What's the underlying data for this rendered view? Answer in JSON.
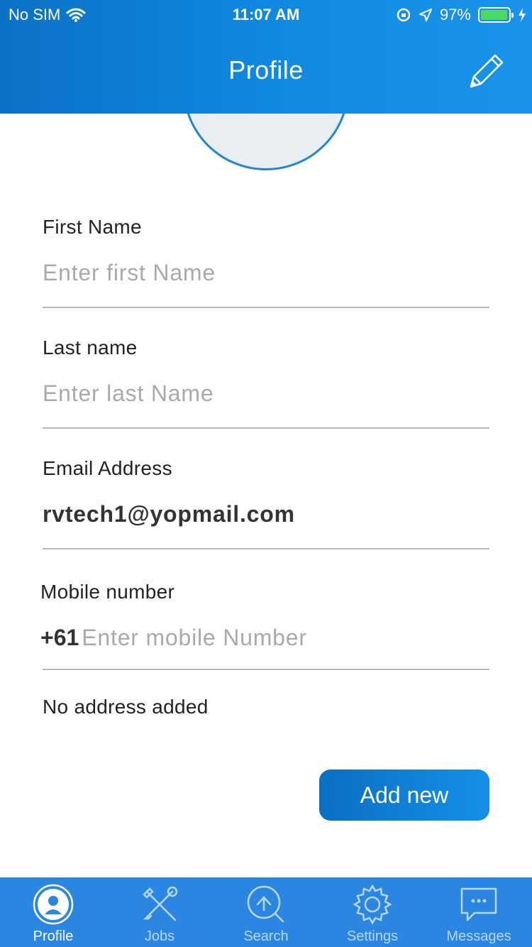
{
  "status_bar": {
    "carrier": "No SIM",
    "time": "11:07 AM",
    "battery_percent": "97%",
    "battery_level": 0.97
  },
  "header": {
    "title": "Profile",
    "edit_icon": "pencil-icon"
  },
  "avatar": {
    "icon": "profile-photo-circle"
  },
  "form": {
    "first_name": {
      "label": "First Name",
      "placeholder": "Enter first Name",
      "value": ""
    },
    "last_name": {
      "label": "Last name",
      "placeholder": "Enter last Name",
      "value": ""
    },
    "email": {
      "label": "Email Address",
      "placeholder": "",
      "value": "rvtech1@yopmail.com"
    },
    "mobile": {
      "label": "Mobile number",
      "country_code": "+61",
      "placeholder": "Enter mobile Number",
      "value": ""
    }
  },
  "address": {
    "empty_text": "No address added"
  },
  "add_button": {
    "label": "Add new"
  },
  "colors": {
    "header": "#118ae2",
    "tabbar": "#2a86e0",
    "accent": "#1e87d8"
  },
  "tabbar": {
    "tabs": [
      {
        "label": "Profile",
        "icon": "profile-icon",
        "active": true
      },
      {
        "label": "Jobs",
        "icon": "tools-icon",
        "active": false
      },
      {
        "label": "Search",
        "icon": "search-icon",
        "active": false
      },
      {
        "label": "Settings",
        "icon": "gear-icon",
        "active": false
      },
      {
        "label": "Messages",
        "icon": "chat-bubble-icon",
        "active": false
      }
    ]
  }
}
